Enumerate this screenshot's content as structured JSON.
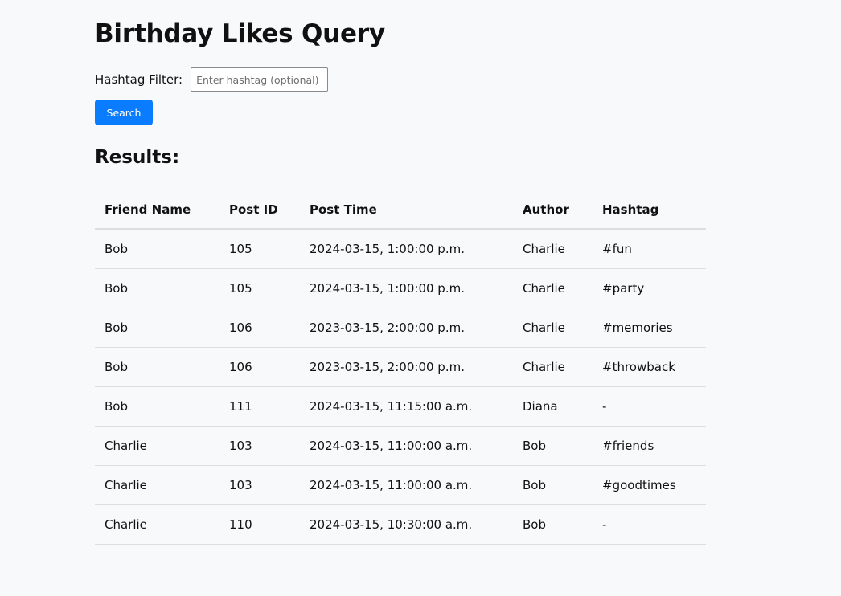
{
  "page": {
    "title": "Birthday Likes Query"
  },
  "filter": {
    "label": "Hashtag Filter:",
    "placeholder": "Enter hashtag (optional)",
    "value": ""
  },
  "search_button": {
    "label": "Search"
  },
  "results": {
    "heading": "Results:",
    "columns": [
      "Friend Name",
      "Post ID",
      "Post Time",
      "Author",
      "Hashtag"
    ],
    "rows": [
      [
        "Bob",
        "105",
        "2024-03-15, 1:00:00 p.m.",
        "Charlie",
        "#fun"
      ],
      [
        "Bob",
        "105",
        "2024-03-15, 1:00:00 p.m.",
        "Charlie",
        "#party"
      ],
      [
        "Bob",
        "106",
        "2023-03-15, 2:00:00 p.m.",
        "Charlie",
        "#memories"
      ],
      [
        "Bob",
        "106",
        "2023-03-15, 2:00:00 p.m.",
        "Charlie",
        "#throwback"
      ],
      [
        "Bob",
        "111",
        "2024-03-15, 11:15:00 a.m.",
        "Diana",
        "-"
      ],
      [
        "Charlie",
        "103",
        "2024-03-15, 11:00:00 a.m.",
        "Bob",
        "#friends"
      ],
      [
        "Charlie",
        "103",
        "2024-03-15, 11:00:00 a.m.",
        "Bob",
        "#goodtimes"
      ],
      [
        "Charlie",
        "110",
        "2024-03-15, 10:30:00 a.m.",
        "Bob",
        "-"
      ]
    ]
  },
  "colors": {
    "background": "#f8f9fb",
    "button": "#0a7cff",
    "divider": "#dedede"
  }
}
